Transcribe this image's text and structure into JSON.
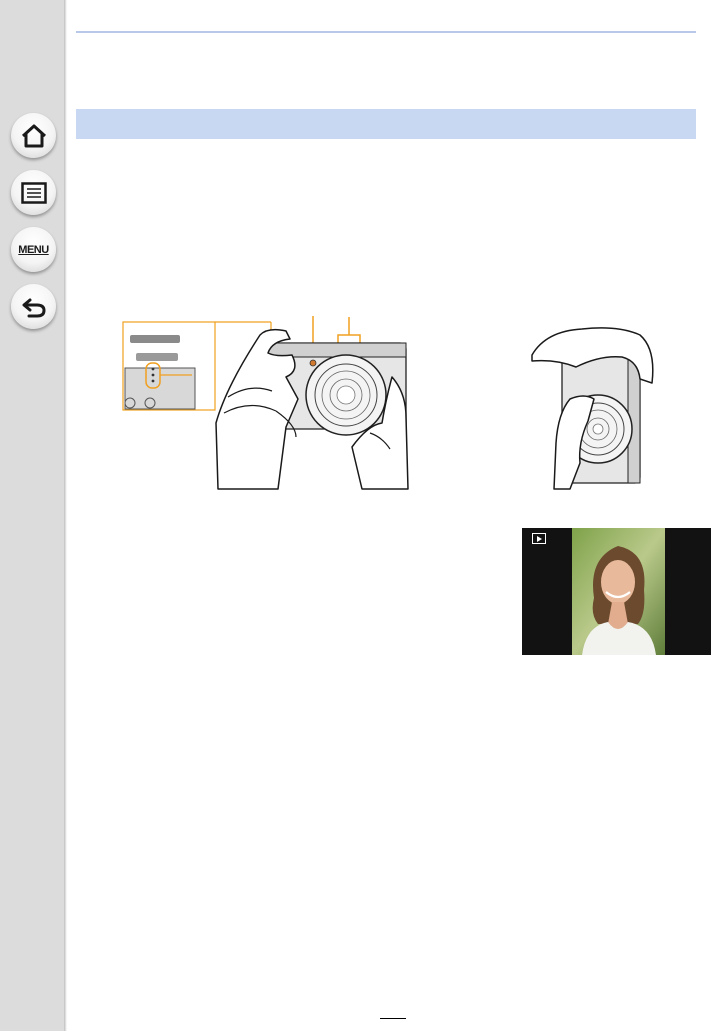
{
  "sidebar": {
    "buttons": [
      {
        "name": "home",
        "icon": "home-icon"
      },
      {
        "name": "contents",
        "icon": "list-icon"
      },
      {
        "name": "menu",
        "icon": "menu-icon",
        "label": "MENU"
      },
      {
        "name": "back",
        "icon": "back-arrow-icon"
      }
    ]
  },
  "colors": {
    "sidebar": "#dcdcdc",
    "section_bar": "#c9d8f2",
    "callout": "#f0a020"
  },
  "figure": {
    "icons": [
      "camera-hands-horizontal-illustration",
      "camera-hands-vertical-illustration",
      "playback-portrait-icon"
    ]
  }
}
